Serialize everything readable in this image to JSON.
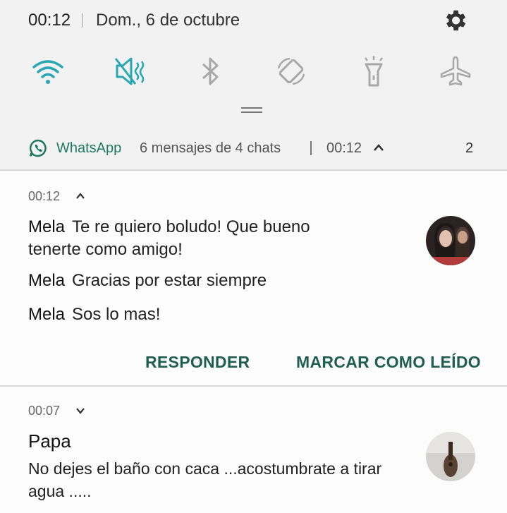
{
  "status_bar": {
    "time": "00:12",
    "date": "Dom., 6 de octubre",
    "settings_icon": "gear-icon"
  },
  "quick_settings": {
    "icons": [
      "wifi-icon",
      "sound-muted-icon",
      "bluetooth-icon",
      "auto-rotate-icon",
      "flashlight-icon",
      "airplane-mode-icon"
    ],
    "active_color": "#2aa7b5",
    "inactive_color": "#a8a8a8"
  },
  "whatsapp_group": {
    "app_name": "WhatsApp",
    "summary": "6 mensajes de 4 chats",
    "time": "00:12",
    "count": "2",
    "brand_color": "#1e7a5f"
  },
  "notifications": [
    {
      "time": "00:12",
      "messages": [
        {
          "sender": "Mela",
          "text": "Te re quiero boludo! Que bueno tenerte como amigo!"
        },
        {
          "sender": "Mela",
          "text": "Gracias por estar siempre"
        },
        {
          "sender": "Mela",
          "text": "Sos lo mas!"
        }
      ],
      "actions": {
        "reply": "RESPONDER",
        "mark_read": "MARCAR COMO LEÍDO"
      }
    },
    {
      "time": "00:07",
      "title": "Papa",
      "message": "No dejes el baño con caca ...acostumbrate a tirar agua ....."
    }
  ]
}
